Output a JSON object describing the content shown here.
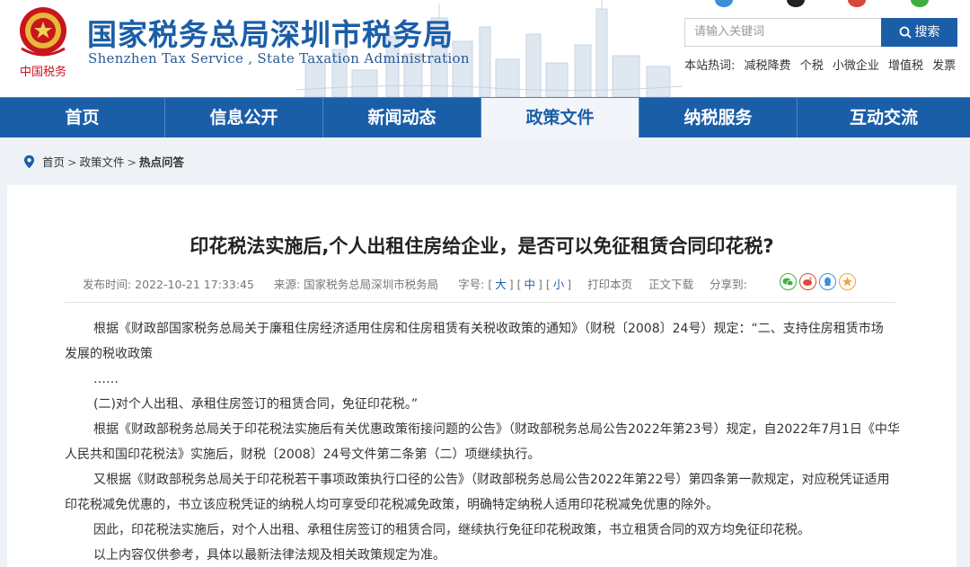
{
  "header": {
    "title": "国家税务总局深圳市税务局",
    "subtitle": "Shenzhen Tax Service , State Taxation Administration",
    "emblem_text": "中国税务",
    "search": {
      "placeholder": "请输入关键词",
      "button_label": "搜索"
    },
    "hot_words_label": "本站热词:",
    "hot_words": [
      "减税降费",
      "个税",
      "小微企业",
      "增值税",
      "发票"
    ],
    "brand_color": "#1b5ea8"
  },
  "nav": {
    "items": [
      {
        "label": "首页"
      },
      {
        "label": "信息公开"
      },
      {
        "label": "新闻动态"
      },
      {
        "label": "政策文件"
      },
      {
        "label": "纳税服务"
      },
      {
        "label": "互动交流"
      }
    ],
    "active": "政策文件"
  },
  "breadcrumb": {
    "items": [
      "首页",
      "政策文件",
      "热点问答"
    ],
    "separator": ">"
  },
  "article": {
    "title": "印花税法实施后,个人出租住房给企业，是否可以免征租赁合同印花税?",
    "meta": {
      "date": "发布时间:  2022-10-21 17:33:45",
      "source": "来源:  国家税务总局深圳市税务局",
      "font_size_label": "字号:",
      "size_large": "大",
      "size_medium": "中",
      "size_small": "小",
      "print_label": "打印本页",
      "download_label": "正文下载",
      "share_label": "分享到:",
      "share_icons": [
        "wechat-icon",
        "weibo-icon",
        "qq-icon",
        "qzone-icon"
      ]
    },
    "paragraphs": [
      "根据《财政部国家税务总局关于廉租住房经济适用住房和住房租赁有关税收政策的通知》（财税〔2008〕24号）规定：“二、支持住房租赁市场",
      "发展的税收政策",
      "……",
      "(二)对个人出租、承租住房签订的租赁合同，免征印花税。”",
      "根据《财政部税务总局关于印花税法实施后有关优惠政策衔接问题的公告》（财政部税务总局公告2022年第23号）规定，自2022年7月1日《中华",
      "人民共和国印花税法》实施后，财税〔2008〕24号文件第二条第（二）项继续执行。",
      "又根据《财政部税务总局关于印花税若干事项政策执行口径的公告》（财政部税务总局公告2022年第22号）第四条第一款规定，对应税凭证适用",
      "印花税减免优惠的，书立该应税凭证的纳税人均可享受印花税减免政策，明确特定纳税人适用印花税减免优惠的除外。",
      "因此，印花税法实施后，对个人出租、承租住房签订的租赁合同，继续执行免征印花税政策，书立租赁合同的双方均免征印花税。",
      "以上内容仅供参考，具体以最新法律法规及相关政策规定为准。"
    ]
  }
}
